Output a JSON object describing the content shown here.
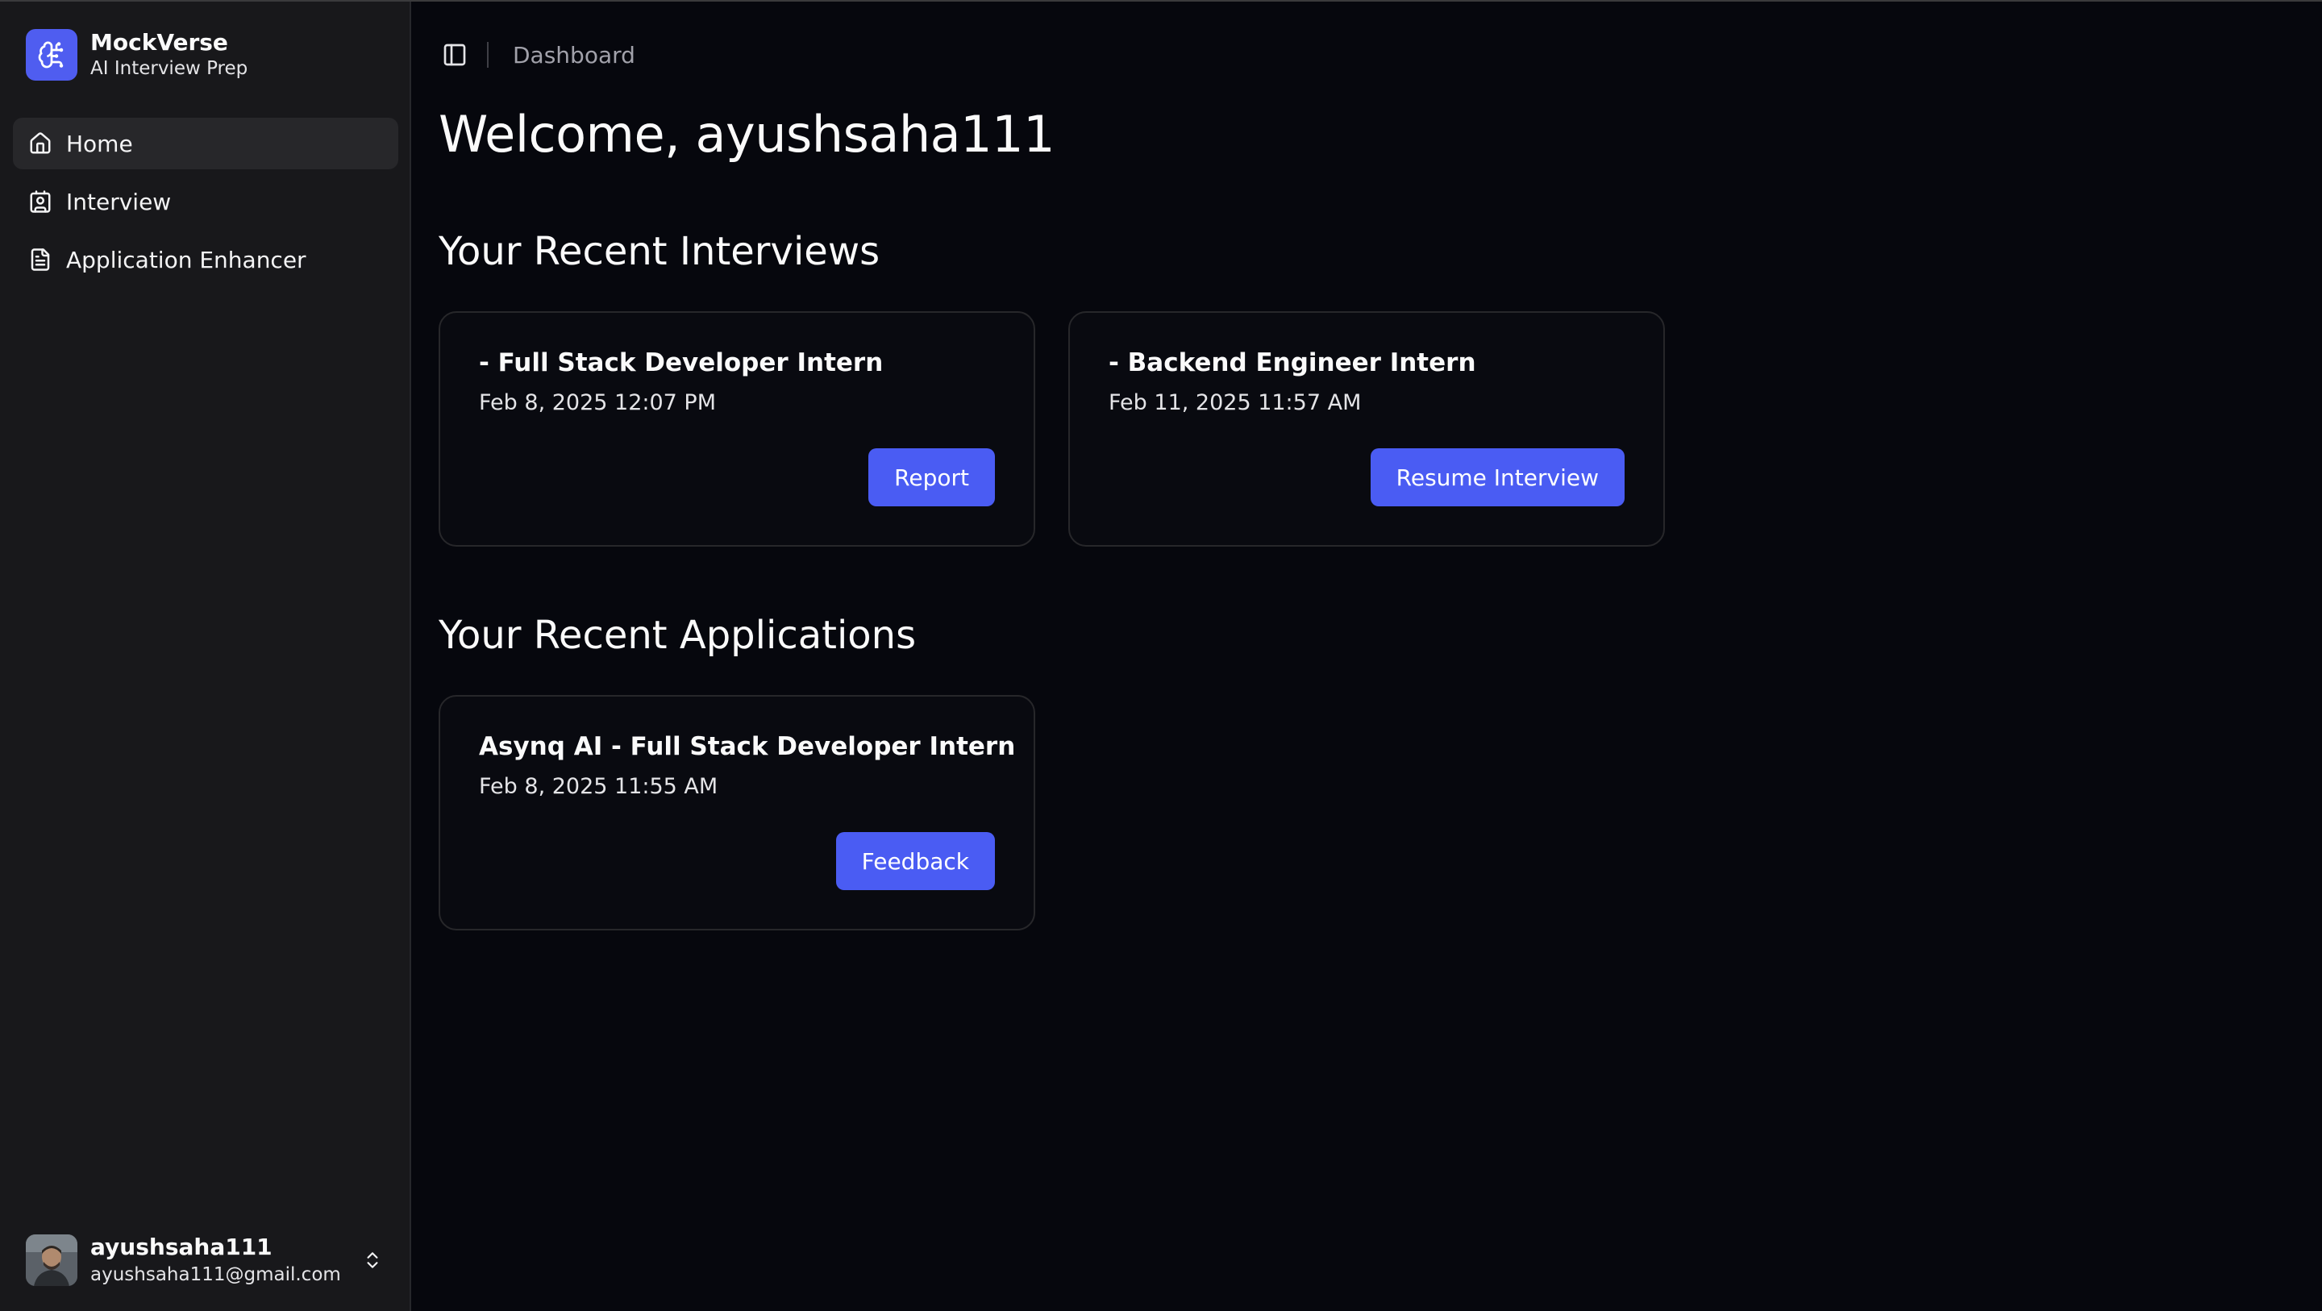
{
  "brand": {
    "name": "MockVerse",
    "subtitle": "AI Interview Prep",
    "logo_icon": "brain-circuit-icon"
  },
  "sidebar": {
    "items": [
      {
        "label": "Home",
        "icon": "home-icon",
        "active": true
      },
      {
        "label": "Interview",
        "icon": "contact-icon",
        "active": false
      },
      {
        "label": "Application Enhancer",
        "icon": "file-text-icon",
        "active": false
      }
    ]
  },
  "user": {
    "name": "ayushsaha111",
    "email": "ayushsaha111@gmail.com"
  },
  "header": {
    "breadcrumb": "Dashboard"
  },
  "main": {
    "welcome": "Welcome, ayushsaha111",
    "interviews_title": "Your Recent Interviews",
    "applications_title": "Your Recent Applications",
    "interviews": [
      {
        "title": "- Full Stack Developer Intern",
        "date": "Feb 8, 2025 12:07 PM",
        "action": "Report"
      },
      {
        "title": "- Backend Engineer Intern",
        "date": "Feb 11, 2025 11:57 AM",
        "action": "Resume Interview"
      }
    ],
    "applications": [
      {
        "title": "Asynq AI - Full Stack Developer Intern",
        "date": "Feb 8, 2025 11:55 AM",
        "action": "Feedback"
      }
    ]
  },
  "colors": {
    "accent": "#4a5cf3",
    "sidebar_bg": "#18181b",
    "main_bg": "#06070d"
  }
}
